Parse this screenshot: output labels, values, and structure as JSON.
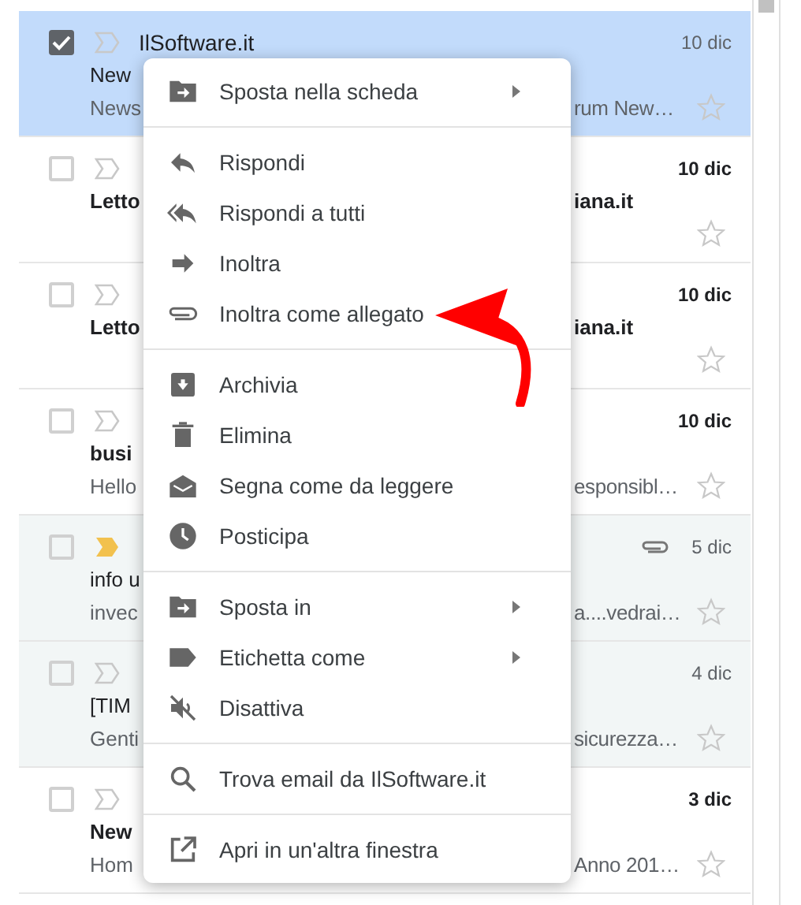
{
  "emails": [
    {
      "checked": true,
      "selected": true,
      "unread": false,
      "important": false,
      "attachment": false,
      "sender": "IlSoftware.it",
      "date": "10 dic",
      "subject": "New",
      "snippet": "News",
      "snippet_right": "rum New…"
    },
    {
      "checked": false,
      "selected": false,
      "unread": true,
      "important": false,
      "attachment": false,
      "date": "10 dic",
      "subject": "Letto",
      "subject_right": "iana.it"
    },
    {
      "checked": false,
      "selected": false,
      "unread": true,
      "important": false,
      "attachment": false,
      "date": "10 dic",
      "subject": "Letto",
      "subject_right": "iana.it"
    },
    {
      "checked": false,
      "selected": false,
      "unread": true,
      "important": false,
      "attachment": false,
      "date": "10 dic",
      "subject": "busi",
      "snippet": "Hello",
      "snippet_right": "esponsibl…"
    },
    {
      "checked": false,
      "selected": false,
      "unread": false,
      "important": true,
      "attachment": true,
      "date": "5 dic",
      "subject": "info u",
      "snippet": "invec",
      "snippet_right": "a....vedrai…"
    },
    {
      "checked": false,
      "selected": false,
      "unread": false,
      "important": false,
      "attachment": false,
      "date": "4 dic",
      "subject": "[TIM",
      "snippet": "Genti",
      "snippet_right": "sicurezza…"
    },
    {
      "checked": false,
      "selected": false,
      "unread": true,
      "important": false,
      "attachment": false,
      "date": "3 dic",
      "subject": "New",
      "snippet": "Hom",
      "snippet_right": "Anno 201…"
    }
  ],
  "context_menu": {
    "sections": [
      [
        {
          "label": "Sposta nella scheda",
          "submenu": true
        }
      ],
      [
        {
          "label": "Rispondi",
          "submenu": false
        },
        {
          "label": "Rispondi a tutti",
          "submenu": false
        },
        {
          "label": "Inoltra",
          "submenu": false
        },
        {
          "label": "Inoltra come allegato",
          "submenu": false
        }
      ],
      [
        {
          "label": "Archivia",
          "submenu": false
        },
        {
          "label": "Elimina",
          "submenu": false
        },
        {
          "label": "Segna come da leggere",
          "submenu": false
        },
        {
          "label": "Posticipa",
          "submenu": false
        }
      ],
      [
        {
          "label": "Sposta in",
          "submenu": true
        },
        {
          "label": "Etichetta come",
          "submenu": true
        },
        {
          "label": "Disattiva",
          "submenu": false
        }
      ],
      [
        {
          "label": "Trova email da IlSoftware.it",
          "submenu": false
        }
      ],
      [
        {
          "label": "Apri in un'altra finestra",
          "submenu": false
        }
      ]
    ]
  }
}
